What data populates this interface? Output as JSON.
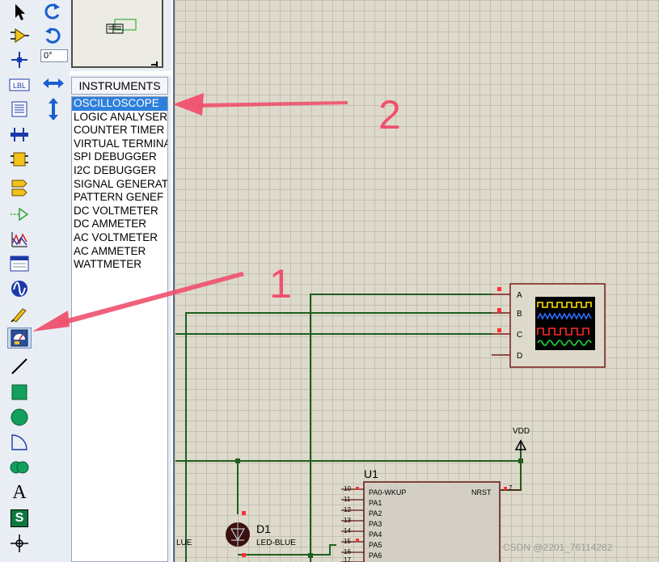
{
  "toolbar": {
    "tools": [
      {
        "name": "selection-tool-icon"
      },
      {
        "name": "component-mode-icon"
      },
      {
        "name": "junction-dot-icon"
      },
      {
        "name": "wire-label-icon",
        "text": "LBL"
      },
      {
        "name": "text-script-icon"
      },
      {
        "name": "bus-icon"
      },
      {
        "name": "subcircuit-icon"
      },
      {
        "name": "terminals-icon"
      },
      {
        "name": "device-pins-icon"
      },
      {
        "name": "graph-icon"
      },
      {
        "name": "tape-recorder-icon"
      },
      {
        "name": "generator-icon"
      },
      {
        "name": "voltage-probe-icon"
      },
      {
        "name": "virtual-instruments-icon"
      },
      {
        "name": "line-tool-icon"
      },
      {
        "name": "box-tool-icon"
      },
      {
        "name": "circle-tool-icon"
      },
      {
        "name": "arc-tool-icon"
      },
      {
        "name": "path-tool-icon"
      },
      {
        "name": "text-tool-icon",
        "text": "A"
      },
      {
        "name": "symbol-tool-icon",
        "text": "S"
      },
      {
        "name": "marker-tool-icon"
      }
    ]
  },
  "rotation": {
    "angle": "0°"
  },
  "devices": {
    "header": "INSTRUMENTS",
    "items": [
      "OSCILLOSCOPE",
      "LOGIC ANALYSER",
      "COUNTER TIMER",
      "VIRTUAL TERMINA",
      "SPI DEBUGGER",
      "I2C DEBUGGER",
      "SIGNAL GENERAT",
      "PATTERN GENEF",
      "DC VOLTMETER",
      "DC AMMETER",
      "AC VOLTMETER",
      "AC AMMETER",
      "WATTMETER"
    ],
    "selected_index": 0
  },
  "annotations": {
    "one": "1",
    "two": "2",
    "arrow_color": "#f0506e"
  },
  "schematic": {
    "scope_channels": [
      "A",
      "B",
      "C",
      "D"
    ],
    "vdd_label": "VDD",
    "mcu": {
      "ref": "U1",
      "pins_left": [
        "PA0-WKUP",
        "PA1",
        "PA2",
        "PA3",
        "PA4",
        "PA5",
        "PA6"
      ],
      "pin_numbers": [
        "10",
        "11",
        "12",
        "13",
        "14",
        "15",
        "16",
        "17"
      ],
      "nrst_label": "NRST",
      "nrst_pin": "7"
    },
    "led": {
      "ref": "D1",
      "value": "LED-BLUE"
    },
    "net_label_fragment": "LUE",
    "wire_color": "#1f5e1f",
    "pin_color": "#ff3030"
  },
  "watermark": "CSDN @2201_76114282"
}
